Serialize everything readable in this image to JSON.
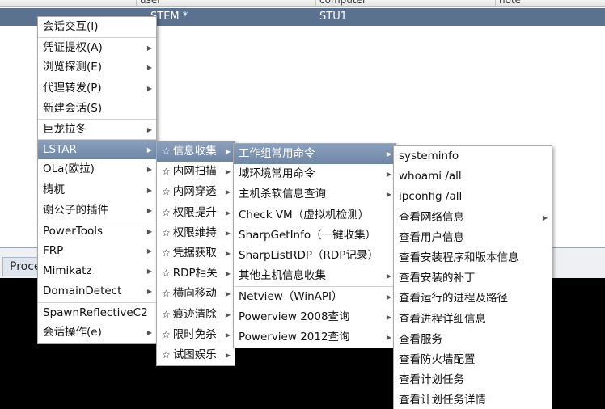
{
  "table": {
    "headers": [
      "user",
      "computer",
      "note"
    ],
    "row": {
      "user": "STEM *",
      "computer": "STU1"
    }
  },
  "bottom": {
    "tab_label": "Proce"
  },
  "menus": {
    "main": [
      {
        "label": "会话交互(I)",
        "sub": false
      },
      {
        "label": "凭证提权(A)",
        "sub": true
      },
      {
        "label": "浏览探测(E)",
        "sub": true
      },
      {
        "label": "代理转发(P)",
        "sub": true
      },
      {
        "label": "新建会话(S)",
        "sub": false
      },
      {
        "label": "巨龙拉冬",
        "sub": true
      },
      {
        "label": "LSTAR",
        "sub": true
      },
      {
        "label": "OLa(欧拉)",
        "sub": true
      },
      {
        "label": "梼杌",
        "sub": true
      },
      {
        "label": "谢公子的插件",
        "sub": true
      },
      {
        "label": "PowerTools",
        "sub": true
      },
      {
        "label": "FRP",
        "sub": true
      },
      {
        "label": "Mimikatz",
        "sub": true
      },
      {
        "label": "DomainDetect",
        "sub": true
      },
      {
        "label": "SpawnReflectiveC2",
        "sub": false
      },
      {
        "label": "会话操作(e)",
        "sub": true
      }
    ],
    "lstar": [
      {
        "label": "信息收集",
        "sub": true
      },
      {
        "label": "内网扫描",
        "sub": true
      },
      {
        "label": "内网穿透",
        "sub": true
      },
      {
        "label": "权限提升",
        "sub": true
      },
      {
        "label": "权限维持",
        "sub": true
      },
      {
        "label": "凭据获取",
        "sub": true
      },
      {
        "label": "RDP相关",
        "sub": true
      },
      {
        "label": "横向移动",
        "sub": true
      },
      {
        "label": "痕迹清除",
        "sub": true
      },
      {
        "label": "限时免杀",
        "sub": true
      },
      {
        "label": "试图娱乐",
        "sub": true
      }
    ],
    "info": [
      {
        "label": "工作组常用命令",
        "sub": true
      },
      {
        "label": "域环境常用命令",
        "sub": true
      },
      {
        "label": "主机杀软信息查询",
        "sub": true
      },
      {
        "label": "Check VM（虚拟机检测）",
        "sub": false
      },
      {
        "label": "SharpGetInfo（一键收集）",
        "sub": false
      },
      {
        "label": "SharpListRDP（RDP记录）",
        "sub": false
      },
      {
        "label": "其他主机信息收集",
        "sub": true
      },
      {
        "label": "Netview（WinAPI）",
        "sub": true
      },
      {
        "label": "Powerview 2008查询",
        "sub": true
      },
      {
        "label": "Powerview 2012查询",
        "sub": true
      }
    ],
    "workgroup": [
      {
        "label": "systeminfo",
        "sub": false
      },
      {
        "label": "whoami /all",
        "sub": false
      },
      {
        "label": "ipconfig /all",
        "sub": false
      },
      {
        "label": "查看网络信息",
        "sub": true
      },
      {
        "label": "查看用户信息",
        "sub": false
      },
      {
        "label": "查看安装程序和版本信息",
        "sub": false
      },
      {
        "label": "查看安装的补丁",
        "sub": false
      },
      {
        "label": "查看运行的进程及路径",
        "sub": false
      },
      {
        "label": "查看进程详细信息",
        "sub": false
      },
      {
        "label": "查看服务",
        "sub": false
      },
      {
        "label": "查看防火墙配置",
        "sub": false
      },
      {
        "label": "查看计划任务",
        "sub": false
      },
      {
        "label": "查看计划任务详情",
        "sub": false
      }
    ]
  },
  "colors": {
    "highlight": "#7b91b0",
    "row": "#5b7190",
    "console": "#000000"
  }
}
